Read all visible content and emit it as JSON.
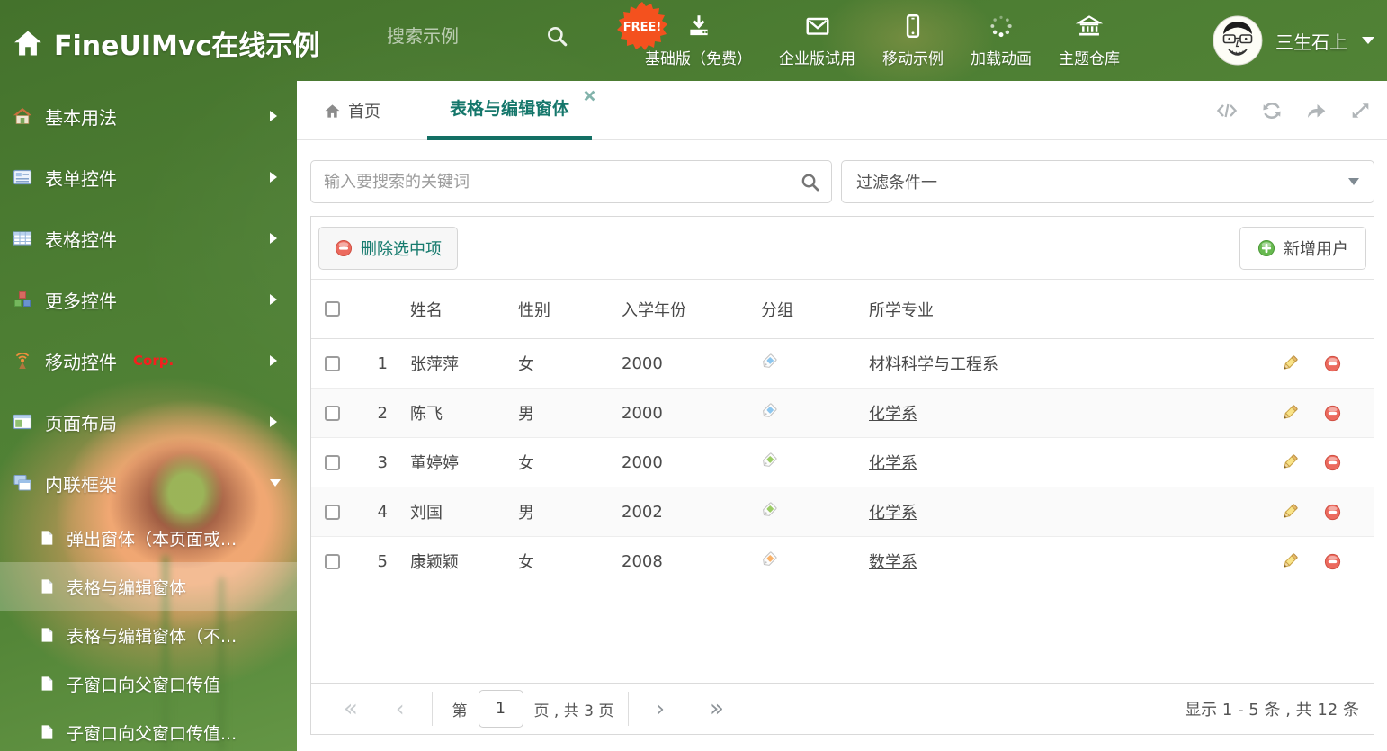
{
  "colors": {
    "accent_teal": "#15776b",
    "header_green": "#4d7e33",
    "free_badge_orange": "#f4511e",
    "corp_red": "#f61e1e",
    "tag_blue": "#8dc6ee",
    "tag_green": "#9ccc65",
    "tag_orange": "#f9b26a",
    "delete_red": "#ec6a5e",
    "add_green": "#67b94f"
  },
  "header": {
    "title": "FineUIMvc在线示例",
    "search_placeholder": "搜索示例",
    "free_badge": "FREE!",
    "nav": [
      {
        "label": "基础版（免费）",
        "icon": "download-icon"
      },
      {
        "label": "企业版试用",
        "icon": "envelope-icon"
      },
      {
        "label": "移动示例",
        "icon": "mobile-icon"
      },
      {
        "label": "加载动画",
        "icon": "spinner-icon"
      },
      {
        "label": "主题仓库",
        "icon": "bank-icon"
      }
    ],
    "user": {
      "name": "三生石上"
    }
  },
  "sidebar": {
    "items": [
      {
        "label": "基本用法",
        "icon": "home-icon"
      },
      {
        "label": "表单控件",
        "icon": "form-icon"
      },
      {
        "label": "表格控件",
        "icon": "table-icon"
      },
      {
        "label": "更多控件",
        "icon": "cubes-icon"
      },
      {
        "label": "移动控件",
        "badge": "Corp.",
        "icon": "antenna-icon"
      },
      {
        "label": "页面布局",
        "icon": "layout-icon"
      },
      {
        "label": "内联框架",
        "icon": "frames-icon",
        "expanded": true
      }
    ],
    "subitems": [
      {
        "label": "弹出窗体（本页面或..."
      },
      {
        "label": "表格与编辑窗体",
        "active": true
      },
      {
        "label": "表格与编辑窗体（不..."
      },
      {
        "label": "子窗口向父窗口传值"
      },
      {
        "label": "子窗口向父窗口传值..."
      }
    ]
  },
  "tabs": {
    "home_label": "首页",
    "active_label": "表格与编辑窗体"
  },
  "filters": {
    "search_placeholder": "输入要搜索的关键词",
    "dropdown_value": "过滤条件一"
  },
  "grid": {
    "toolbar": {
      "delete_label": "删除选中项",
      "add_label": "新增用户"
    },
    "columns": [
      "姓名",
      "性别",
      "入学年份",
      "分组",
      "所学专业"
    ],
    "rows": [
      {
        "index": "1",
        "name": "张萍萍",
        "gender": "女",
        "year": "2000",
        "tag_color": "#8dc6ee",
        "major": "材料科学与工程系"
      },
      {
        "index": "2",
        "name": "陈飞",
        "gender": "男",
        "year": "2000",
        "tag_color": "#8dc6ee",
        "major": "化学系"
      },
      {
        "index": "3",
        "name": "董婷婷",
        "gender": "女",
        "year": "2000",
        "tag_color": "#9ccc65",
        "major": "化学系"
      },
      {
        "index": "4",
        "name": "刘国",
        "gender": "男",
        "year": "2002",
        "tag_color": "#9ccc65",
        "major": "化学系"
      },
      {
        "index": "5",
        "name": "康颖颖",
        "gender": "女",
        "year": "2008",
        "tag_color": "#f9b26a",
        "major": "数学系"
      }
    ],
    "pagination": {
      "first": "«",
      "prev": "‹",
      "next": "›",
      "last": "»",
      "page_prefix": "第",
      "page": "1",
      "page_suffix": "页 , 共 3 页",
      "summary": "显示 1 - 5 条 , 共 12 条"
    }
  }
}
